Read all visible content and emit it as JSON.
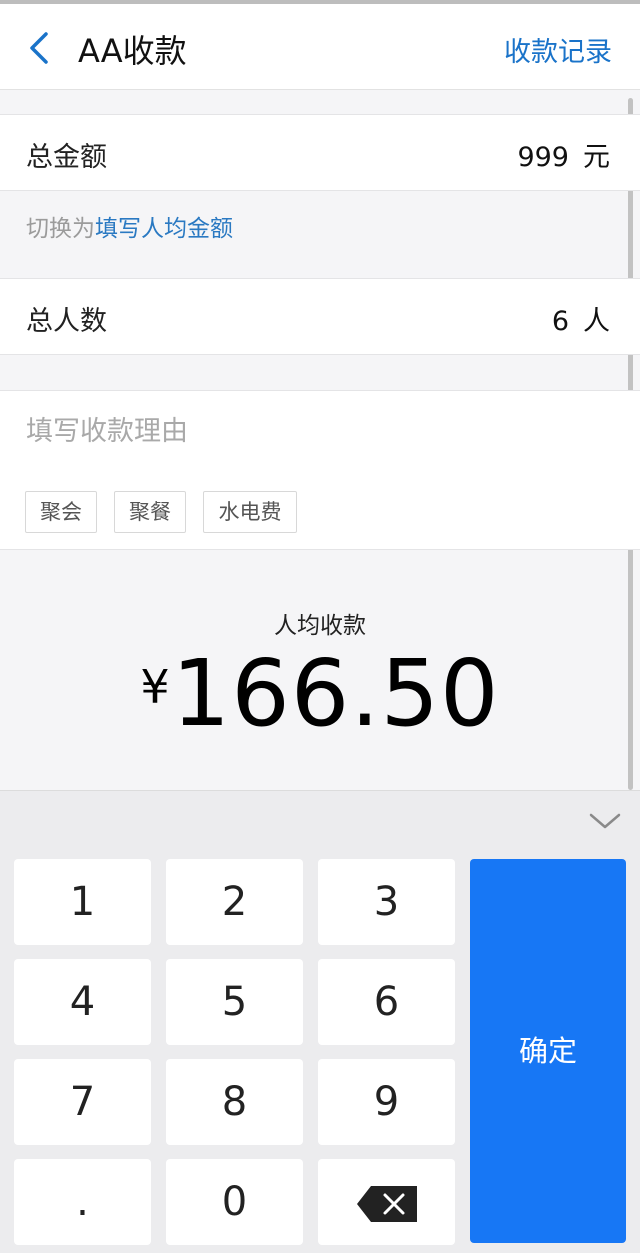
{
  "header": {
    "title": "AA收款",
    "right_link": "收款记录"
  },
  "total_amount": {
    "label": "总金额",
    "value": "999",
    "unit": "元"
  },
  "switch_hint": {
    "prefix": "切换为",
    "link": "填写人均金额"
  },
  "people": {
    "label": "总人数",
    "value": "6",
    "unit": "人"
  },
  "reason": {
    "placeholder": "填写收款理由",
    "tags": [
      "聚会",
      "聚餐",
      "水电费"
    ]
  },
  "per_person": {
    "label": "人均收款",
    "currency": "¥",
    "amount": "166.50"
  },
  "keypad": {
    "keys": [
      "1",
      "2",
      "3",
      "4",
      "5",
      "6",
      "7",
      "8",
      "9",
      ".",
      "0"
    ],
    "confirm": "确定"
  },
  "colors": {
    "accent": "#1a73c9",
    "confirm_bg": "#1777f5"
  }
}
